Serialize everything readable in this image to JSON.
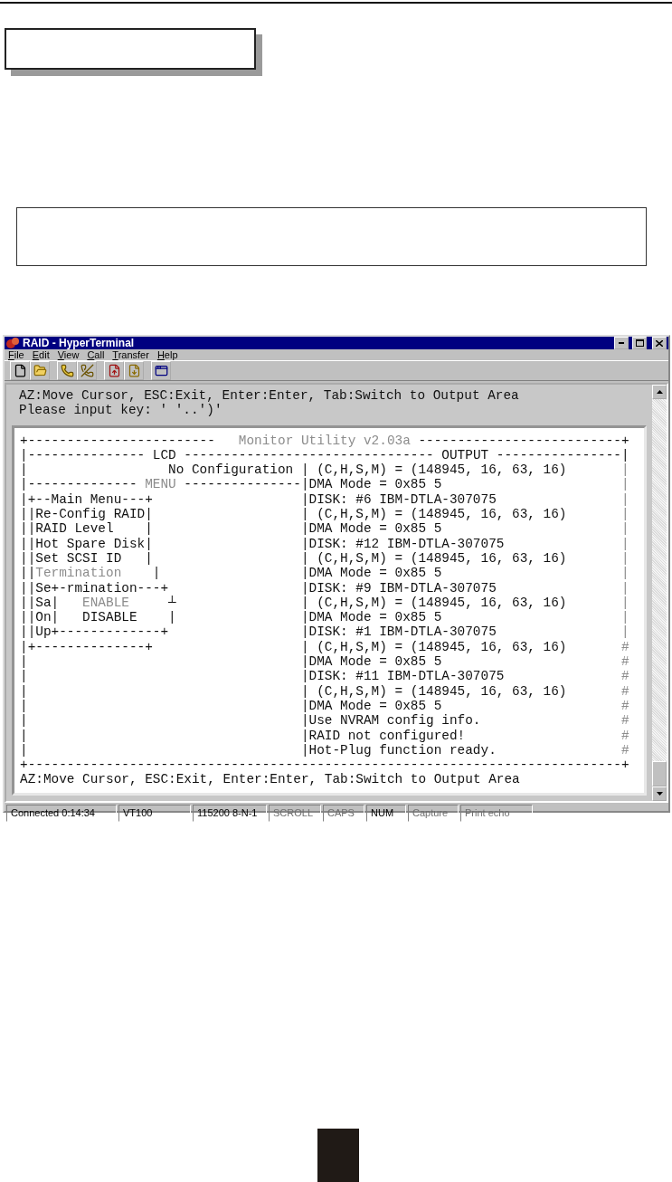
{
  "window": {
    "title": "RAID - HyperTerminal"
  },
  "menu": [
    "File",
    "Edit",
    "View",
    "Call",
    "Transfer",
    "Help"
  ],
  "terminal": {
    "prompt_lines": [
      "AZ:Move Cursor, ESC:Exit, Enter:Enter, Tab:Switch to Output Area",
      "Please input key: ' '..')'"
    ],
    "screen_lines": [
      {
        "kind": "full",
        "parts": [
          {
            "text": "+------------------------   ",
            "dim": false
          },
          {
            "text": "Monitor Utility v2.03a",
            "dim": true
          },
          {
            "text": " --------------------------+",
            "dim": false
          }
        ]
      },
      {
        "kind": "full",
        "parts": [
          {
            "text": "|--------------- LCD -------------------------------- OUTPUT ----------------|",
            "dim": false
          }
        ]
      },
      {
        "kind": "split",
        "left": [
          {
            "text": "|                  No Configuration ",
            "dim": false
          }
        ],
        "right": "| (C,H,S,M) = (148945, 16, 63, 16)",
        "end": "|"
      },
      {
        "kind": "split",
        "left": [
          {
            "text": "|-------------- ",
            "dim": false
          },
          {
            "text": "MENU",
            "dim": true
          },
          {
            "text": " ---------------",
            "dim": false
          }
        ],
        "right": "|DMA Mode = 0x85 5",
        "end": "|"
      },
      {
        "kind": "split",
        "left": [
          {
            "text": "|+--Main Menu---+",
            "dim": false
          }
        ],
        "right": "|DISK: #6 IBM-DTLA-307075",
        "end": "|"
      },
      {
        "kind": "split",
        "left": [
          {
            "text": "||Re-Config RAID|",
            "dim": false
          }
        ],
        "right": "| (C,H,S,M) = (148945, 16, 63, 16)",
        "end": "|"
      },
      {
        "kind": "split",
        "left": [
          {
            "text": "||RAID Level    |",
            "dim": false
          }
        ],
        "right": "|DMA Mode = 0x85 5",
        "end": "|"
      },
      {
        "kind": "split",
        "left": [
          {
            "text": "||Hot Spare Disk|",
            "dim": false
          }
        ],
        "right": "|DISK: #12 IBM-DTLA-307075",
        "end": "|"
      },
      {
        "kind": "split",
        "left": [
          {
            "text": "||Set SCSI ID   |",
            "dim": false
          }
        ],
        "right": "| (C,H,S,M) = (148945, 16, 63, 16)",
        "end": "|"
      },
      {
        "kind": "split",
        "left": [
          {
            "text": "||",
            "dim": false
          },
          {
            "text": "Termination",
            "dim": true
          },
          {
            "text": "    |",
            "dim": false
          }
        ],
        "right": "|DMA Mode = 0x85 5",
        "end": "|"
      },
      {
        "kind": "split",
        "left": [
          {
            "text": "||Se+-rmination---+",
            "dim": false
          }
        ],
        "right": "|DISK: #9 IBM-DTLA-307075",
        "end": "|"
      },
      {
        "kind": "split",
        "left": [
          {
            "text": "||Sa|   ",
            "dim": false
          },
          {
            "text": "ENABLE",
            "dim": true
          },
          {
            "text": "     ┴",
            "dim": false
          }
        ],
        "right": "| (C,H,S,M) = (148945, 16, 63, 16)",
        "end": "|"
      },
      {
        "kind": "split",
        "left": [
          {
            "text": "||On|   DISABLE    |",
            "dim": false
          }
        ],
        "right": "|DMA Mode = 0x85 5",
        "end": "|"
      },
      {
        "kind": "split",
        "left": [
          {
            "text": "||Up+-------------+",
            "dim": false
          }
        ],
        "right": "|DISK: #1 IBM-DTLA-307075",
        "end": "|"
      },
      {
        "kind": "split",
        "left": [
          {
            "text": "|+--------------+",
            "dim": false
          }
        ],
        "right": "| (C,H,S,M) = (148945, 16, 63, 16)",
        "end": "#"
      },
      {
        "kind": "split",
        "left": [
          {
            "text": "|",
            "dim": false
          }
        ],
        "right": "|DMA Mode = 0x85 5",
        "end": "#"
      },
      {
        "kind": "split",
        "left": [
          {
            "text": "|",
            "dim": false
          }
        ],
        "right": "|DISK: #11 IBM-DTLA-307075",
        "end": "#"
      },
      {
        "kind": "split",
        "left": [
          {
            "text": "|",
            "dim": false
          }
        ],
        "right": "| (C,H,S,M) = (148945, 16, 63, 16)",
        "end": "#"
      },
      {
        "kind": "split",
        "left": [
          {
            "text": "|",
            "dim": false
          }
        ],
        "right": "|DMA Mode = 0x85 5",
        "end": "#"
      },
      {
        "kind": "split",
        "left": [
          {
            "text": "|",
            "dim": false
          }
        ],
        "right": "|Use NVRAM config info.",
        "end": "#"
      },
      {
        "kind": "split",
        "left": [
          {
            "text": "|",
            "dim": false
          }
        ],
        "right": "|RAID not configured!",
        "end": "#"
      },
      {
        "kind": "split",
        "left": [
          {
            "text": "|",
            "dim": false
          }
        ],
        "right": "|Hot-Plug function ready.",
        "end": "#"
      },
      {
        "kind": "full",
        "parts": [
          {
            "text": "+----------------------------------------------------------------------------+",
            "dim": false
          }
        ]
      },
      {
        "kind": "full",
        "parts": [
          {
            "text": "AZ:Move Cursor, ESC:Exit, Enter:Enter, Tab:Switch to Output Area",
            "dim": false
          }
        ]
      }
    ]
  },
  "status_bar": [
    {
      "text": "Connected 0:14:34",
      "disabled": false
    },
    {
      "text": "VT100",
      "disabled": false
    },
    {
      "text": "115200 8-N-1",
      "disabled": false
    },
    {
      "text": "SCROLL",
      "disabled": true
    },
    {
      "text": "CAPS",
      "disabled": true
    },
    {
      "text": "NUM",
      "disabled": false
    },
    {
      "text": "Capture",
      "disabled": true
    },
    {
      "text": "Print echo",
      "disabled": true
    }
  ]
}
